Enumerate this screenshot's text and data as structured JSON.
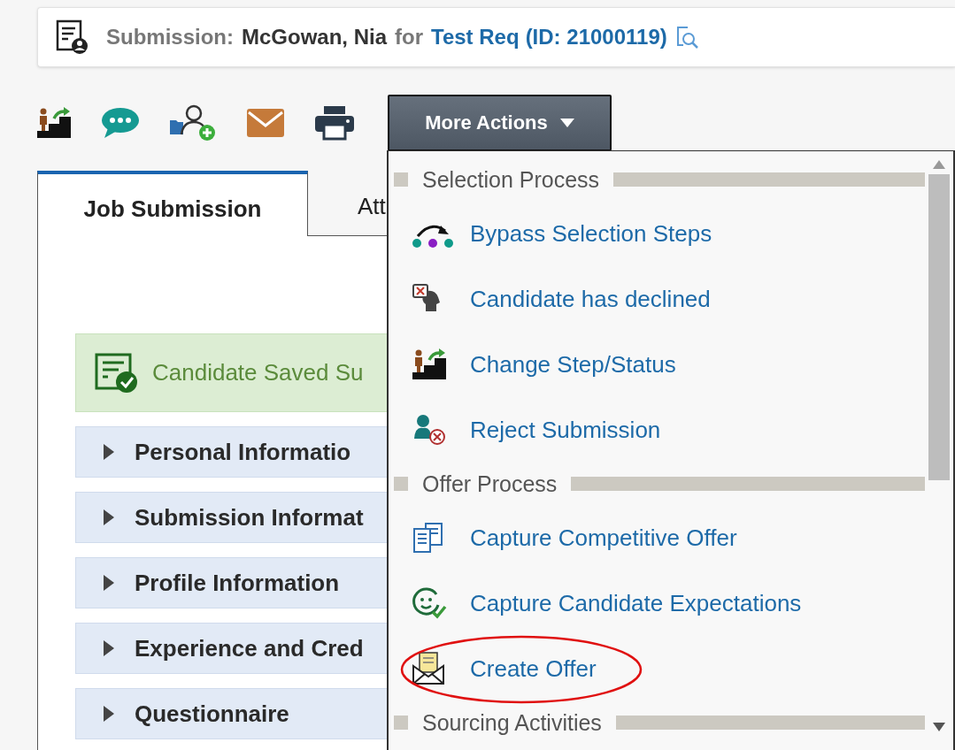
{
  "header": {
    "label": "Submission:",
    "candidate": "McGowan, Nia",
    "connector": "for",
    "requisition": "Test Req",
    "id": "(ID: 21000119)"
  },
  "toolbar": {
    "more_actions": "More Actions",
    "menu_open": true
  },
  "tabs": [
    {
      "label": "Job Submission",
      "selected": true
    },
    {
      "label": "Att",
      "selected": false
    }
  ],
  "banner": {
    "message": "Candidate Saved Su"
  },
  "sections": [
    {
      "title": "Personal Informatio",
      "expanded": false
    },
    {
      "title": "Submission Informat",
      "expanded": false
    },
    {
      "title": "Profile Information",
      "expanded": false
    },
    {
      "title": "Experience and Cred",
      "expanded": false
    },
    {
      "title": "Questionnaire",
      "expanded": false
    }
  ],
  "menu": {
    "groups": [
      {
        "title": "Selection Process",
        "items": [
          {
            "label": "Bypass Selection Steps",
            "kind": "bypass",
            "highlighted": false
          },
          {
            "label": "Candidate has declined",
            "kind": "declined",
            "highlighted": false
          },
          {
            "label": "Change Step/Status",
            "kind": "step",
            "highlighted": false
          },
          {
            "label": "Reject Submission",
            "kind": "reject",
            "highlighted": false
          }
        ]
      },
      {
        "title": "Offer Process",
        "items": [
          {
            "label": "Capture Competitive Offer",
            "kind": "competitive",
            "highlighted": false
          },
          {
            "label": "Capture Candidate Expectations",
            "kind": "expectations",
            "highlighted": false
          },
          {
            "label": "Create Offer",
            "kind": "offer",
            "highlighted": true
          }
        ]
      },
      {
        "title": "Sourcing Activities"
      }
    ]
  }
}
